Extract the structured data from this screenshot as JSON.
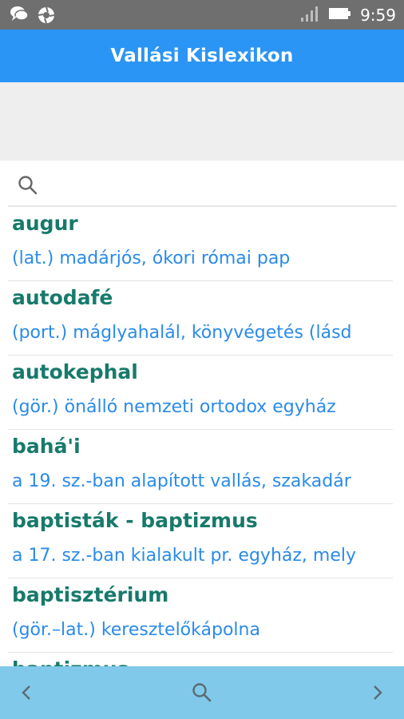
{
  "status_bar": {
    "time": "9:59",
    "icons": [
      "chat-icon",
      "aperture-icon",
      "signal-icon",
      "battery-icon"
    ]
  },
  "app_bar": {
    "title": "Vallási Kislexikon"
  },
  "search": {
    "value": "",
    "placeholder": ""
  },
  "entries": [
    {
      "term": "augur",
      "definition": "(lat.) madárjós, ókori római pap"
    },
    {
      "term": "autodafé",
      "definition": "(port.) máglyahalál, könyvégetés (lásd"
    },
    {
      "term": "autokephal",
      "definition": "(gör.) önálló nemzeti ortodox egyház"
    },
    {
      "term": "bahá'i",
      "definition": "a 19. sz.-ban alapított vallás, szakadár"
    },
    {
      "term": "baptisták - baptizmus",
      "definition": "a 17. sz.-ban kialakult pr. egyház, mely"
    },
    {
      "term": "baptisztérium",
      "definition": "(gör.–lat.) keresztelőkápolna"
    },
    {
      "term": "baptizmus",
      "definition": ""
    }
  ],
  "bottom_nav": {
    "prev_icon": "chevron-left-icon",
    "search_icon": "search-icon",
    "next_icon": "chevron-right-icon"
  },
  "colors": {
    "app_bar": "#2a95f5",
    "term": "#177a6b",
    "definition": "#2a8bea",
    "bottom_bar": "#80c9ea"
  }
}
